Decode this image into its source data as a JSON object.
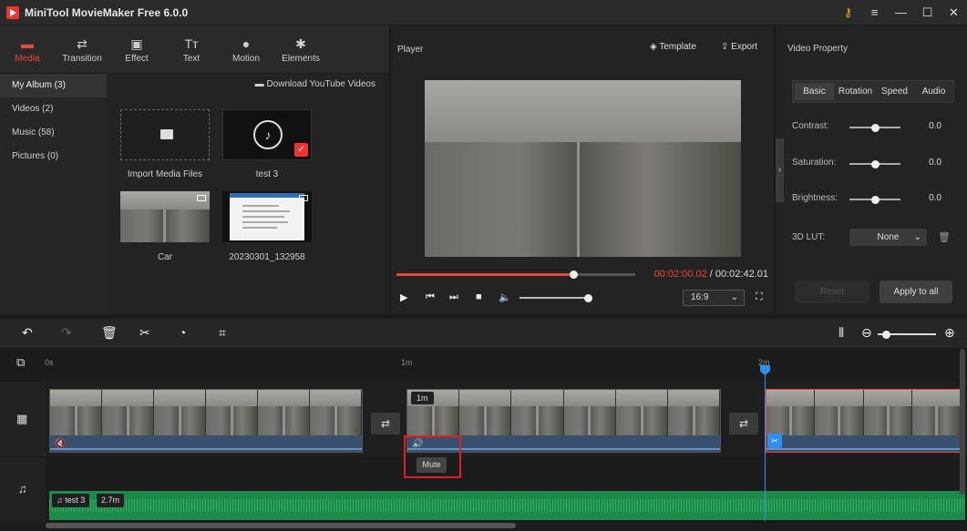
{
  "window": {
    "title": "MiniTool MovieMaker Free 6.0.0"
  },
  "toolbar_tabs": [
    {
      "label": "Media",
      "icon": "folder-icon"
    },
    {
      "label": "Transition",
      "icon": "transition-icon"
    },
    {
      "label": "Effect",
      "icon": "effect-icon"
    },
    {
      "label": "Text",
      "icon": "text-icon"
    },
    {
      "label": "Motion",
      "icon": "motion-icon"
    },
    {
      "label": "Elements",
      "icon": "elements-icon"
    }
  ],
  "album": {
    "items": [
      "My Album (3)",
      "Videos (2)",
      "Music (58)",
      "Pictures (0)"
    ],
    "download_label": "Download YouTube Videos"
  },
  "media_tiles": {
    "import_label": "Import Media Files",
    "music_label": "test 3",
    "car_label": "Car",
    "screenshot_label": "20230301_132958"
  },
  "player": {
    "title": "Player",
    "template_label": "Template",
    "export_label": "Export",
    "current_time": "00:02:00.02",
    "separator": " / ",
    "total_time": "00:02:42.01",
    "aspect_ratio": "16:9",
    "progress": 0.74,
    "volume": 1.0
  },
  "property": {
    "title": "Video Property",
    "tabs": [
      "Basic",
      "Rotation",
      "Speed",
      "Audio"
    ],
    "contrast_label": "Contrast:",
    "contrast_value": "0.0",
    "saturation_label": "Saturation:",
    "saturation_value": "0.0",
    "brightness_label": "Brightness:",
    "brightness_value": "0.0",
    "lut_label": "3D LUT:",
    "lut_value": "None",
    "reset_label": "Reset",
    "apply_label": "Apply to all"
  },
  "timeline": {
    "ruler": [
      "0s",
      "1m",
      "2m"
    ],
    "clip_duration_badge": "1m",
    "mute_tooltip": "Mute",
    "audio_clip_name": "test 3",
    "audio_clip_duration": "2.7m"
  },
  "colors": {
    "accent": "#e84a3a",
    "playhead": "#2f8ff0",
    "audio_track": "#1e8a49",
    "highlight_box": "#e02020"
  }
}
